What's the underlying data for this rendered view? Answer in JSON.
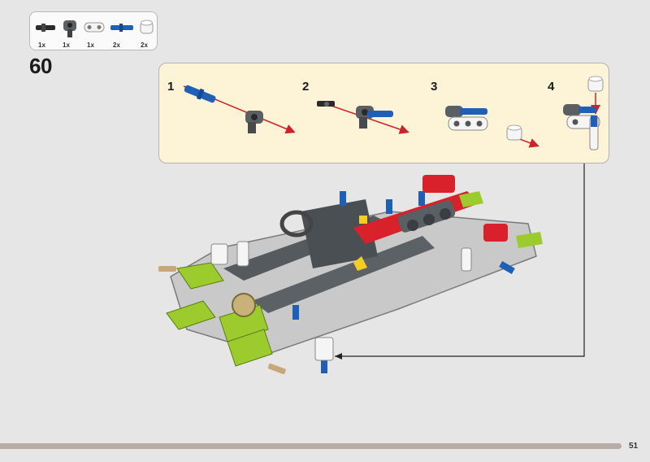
{
  "page": {
    "number": "51"
  },
  "step": {
    "number": "60"
  },
  "parts_list": [
    {
      "qty": "1x",
      "part": "black-axle-pin"
    },
    {
      "qty": "1x",
      "part": "dark-gray-pin-connector"
    },
    {
      "qty": "1x",
      "part": "white-beam"
    },
    {
      "qty": "2x",
      "part": "blue-axle-pin"
    },
    {
      "qty": "2x",
      "part": "white-bush"
    }
  ],
  "substeps": [
    {
      "number": "1"
    },
    {
      "number": "2"
    },
    {
      "number": "3"
    },
    {
      "number": "4"
    }
  ],
  "colors": {
    "background": "#e6e6e6",
    "substep_panel": "#fdf4d7",
    "arrow": "#d0202a",
    "blue_pin": "#1f5fb5",
    "lime": "#9ccb2e",
    "technic_red": "#d8212a",
    "dark_gray": "#555a5f",
    "light_gray": "#b8b8b8"
  }
}
